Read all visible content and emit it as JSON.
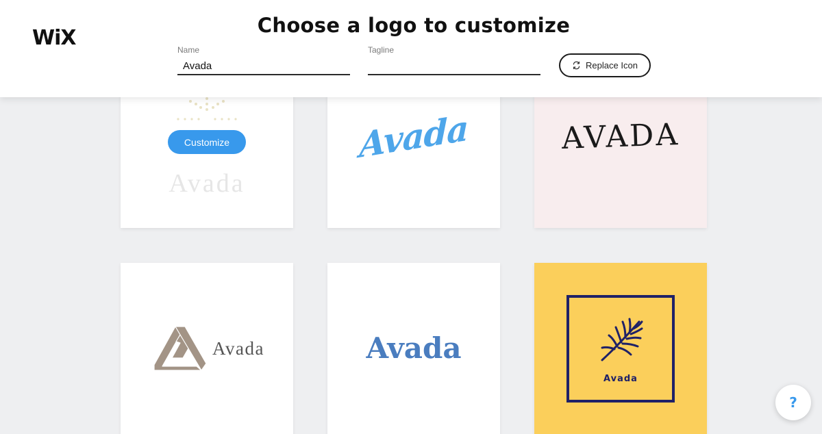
{
  "header": {
    "brand": "WiX",
    "title": "Choose a logo to customize",
    "name_label": "Name",
    "name_value": "Avada",
    "tagline_label": "Tagline",
    "tagline_value": "",
    "replace_icon_label": "Replace Icon"
  },
  "cards": [
    {
      "id": "card-1",
      "word": "Avada",
      "button": "Customize",
      "hovered": true
    },
    {
      "id": "card-2",
      "word": "Avada"
    },
    {
      "id": "card-3",
      "word": "AVADA"
    },
    {
      "id": "card-4",
      "word": "Avada",
      "icon": "impossible-triangle-icon"
    },
    {
      "id": "card-5",
      "word": "Avada"
    },
    {
      "id": "card-6",
      "word": "Avada",
      "icon": "palm-leaf-icon"
    }
  ],
  "help": {
    "label": "?"
  },
  "colors": {
    "accent_blue": "#3899ec",
    "page_bg": "#eeeff1",
    "card_pink": "#f8edee",
    "card_yellow": "#fbcf5b",
    "navy": "#1f2167"
  }
}
